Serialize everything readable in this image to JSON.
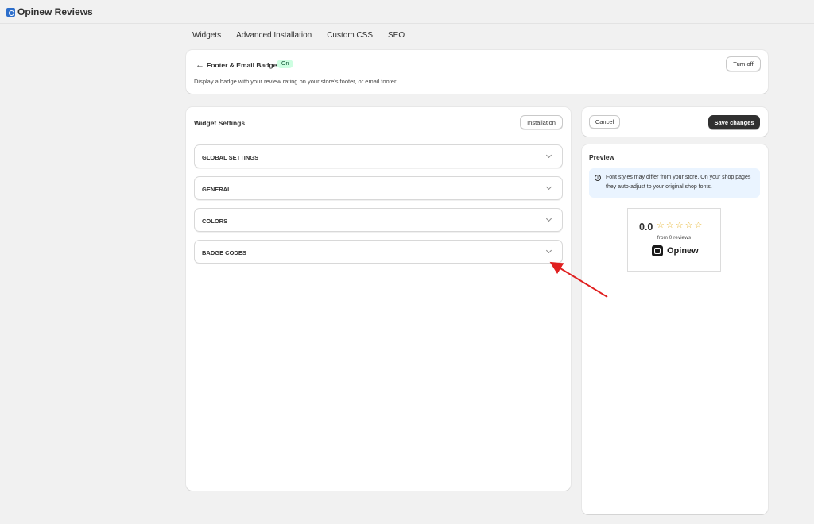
{
  "app": {
    "title": "Opinew Reviews",
    "logo_icon": "opinew-app-icon"
  },
  "tabs": [
    {
      "label": "Widgets"
    },
    {
      "label": "Advanced Installation"
    },
    {
      "label": "Custom CSS"
    },
    {
      "label": "SEO"
    }
  ],
  "header": {
    "back_icon": "arrow-left-icon",
    "title": "Footer & Email Badge",
    "status": "On",
    "status_color": "#cdfee1",
    "description": "Display a badge with your review rating on your store's footer, or email footer.",
    "turn_off_label": "Turn off"
  },
  "settings": {
    "title": "Widget Settings",
    "installation_label": "Installation",
    "sections": [
      {
        "label": "GLOBAL SETTINGS"
      },
      {
        "label": "GENERAL"
      },
      {
        "label": "COLORS"
      },
      {
        "label": "BADGE CODES"
      }
    ]
  },
  "actions": {
    "cancel_label": "Cancel",
    "save_label": "Save changes",
    "save_color": "#303030"
  },
  "preview": {
    "title": "Preview",
    "info_icon": "info-circle-icon",
    "info_text": "Font styles may differ from your store. On your shop pages they auto-adjust to your original shop fonts.",
    "info_bg": "#eaf4ff",
    "badge": {
      "rating": "0.0",
      "stars_filled": 0,
      "stars_total": 5,
      "star_color": "#e6b530",
      "reviews_text": "from 0 reviews",
      "brand": "Opinew"
    }
  },
  "annotation": {
    "type": "arrow",
    "color": "#e02020",
    "points_to": "BADGE CODES chevron"
  }
}
